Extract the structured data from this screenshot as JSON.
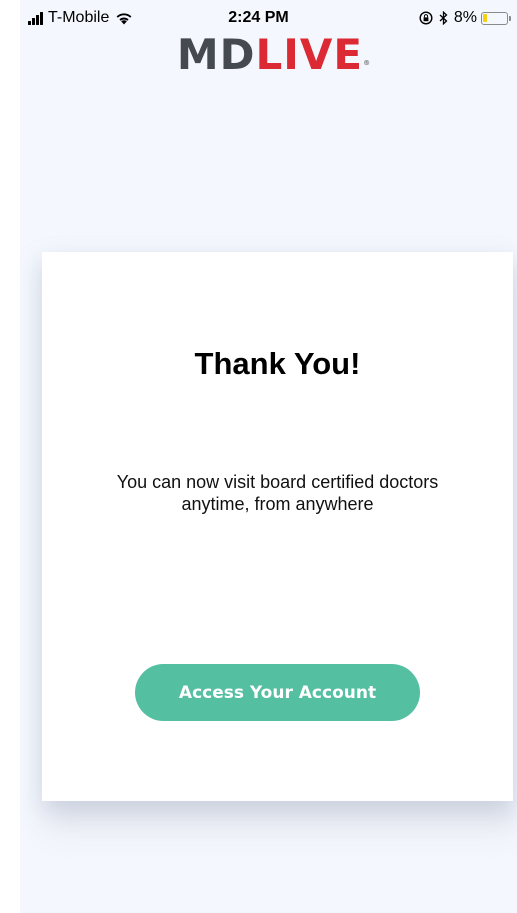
{
  "status_bar": {
    "carrier": "T-Mobile",
    "time": "2:24 PM",
    "battery_percent_text": "8%",
    "battery_level": 0.08,
    "icons": [
      "signal-icon",
      "wifi-icon",
      "rotation-lock-icon",
      "bluetooth-icon",
      "battery-icon"
    ]
  },
  "logo": {
    "part_md": "MD",
    "part_live": "LIVE",
    "reg_mark": "®"
  },
  "card": {
    "title": "Thank You!",
    "message": "You can now visit board certified doctors anytime, from anywhere",
    "button_label": "Access Your Account"
  },
  "colors": {
    "brand_gray": "#454a50",
    "brand_red": "#dc2a34",
    "button_green": "#55bfa2",
    "background": "#f4f7fd",
    "battery_low": "#f5d20f"
  }
}
